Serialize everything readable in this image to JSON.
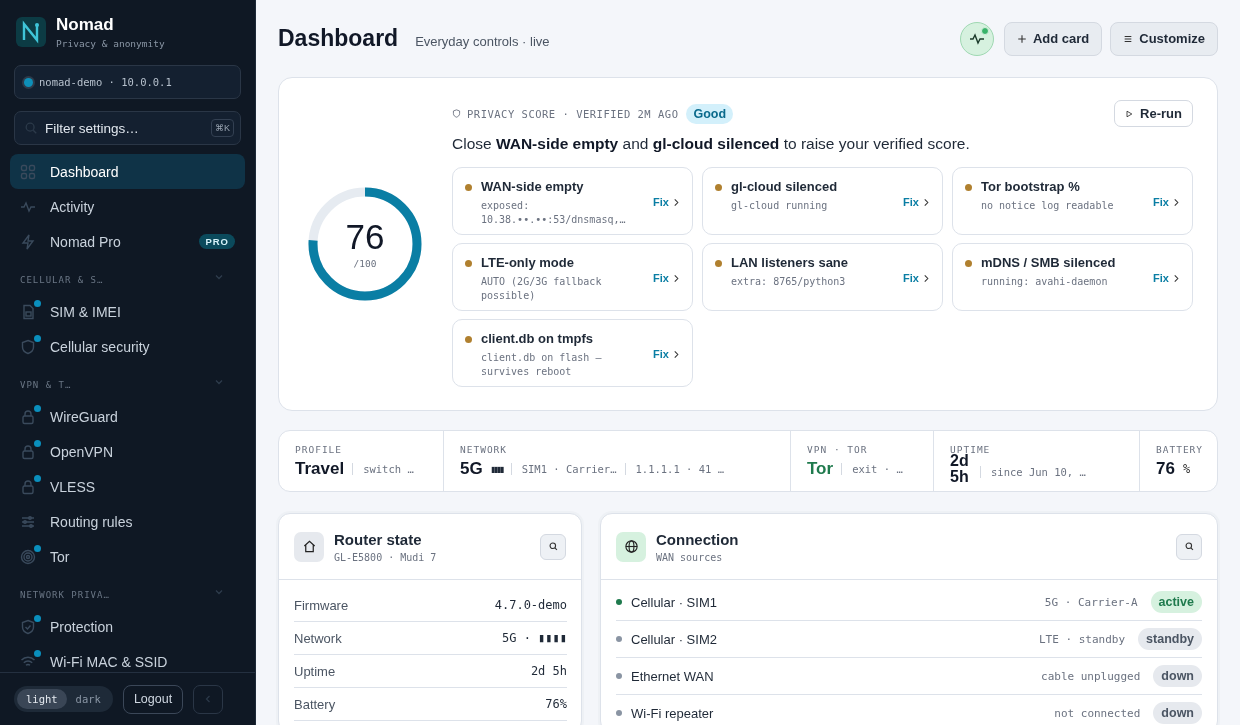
{
  "brand": {
    "name": "Nomad",
    "tagline": "Privacy & anonymity"
  },
  "device": {
    "label": "nomad-demo · 10.0.0.1",
    "online": true
  },
  "filter": {
    "placeholder": "Filter settings…",
    "shortcut": "⌘K"
  },
  "nav": [
    {
      "label": "Dashboard",
      "selected": true,
      "dot": false
    },
    {
      "label": "Activity",
      "selected": false,
      "dot": false
    },
    {
      "label": "Nomad Pro",
      "selected": false,
      "dot": false,
      "badge": "PRO"
    }
  ],
  "sections": [
    {
      "title": "CELLULAR & S…",
      "expanded": true,
      "items": [
        {
          "label": "SIM & IMEI",
          "selected": false,
          "dot": true
        },
        {
          "label": "Cellular security",
          "selected": false,
          "dot": true
        }
      ]
    },
    {
      "title": "VPN & T…",
      "expanded": true,
      "items": [
        {
          "label": "WireGuard",
          "selected": false,
          "dot": true
        },
        {
          "label": "OpenVPN",
          "selected": false,
          "dot": true
        },
        {
          "label": "VLESS",
          "selected": false,
          "dot": true
        },
        {
          "label": "Routing rules",
          "selected": false,
          "dot": false
        },
        {
          "label": "Tor",
          "selected": false,
          "dot": true
        }
      ]
    },
    {
      "title": "NETWORK PRIVA…",
      "expanded": true,
      "items": [
        {
          "label": "Protection",
          "selected": false,
          "dot": true
        },
        {
          "label": "Wi-Fi MAC & SSID",
          "selected": false,
          "dot": true
        }
      ]
    }
  ],
  "theme": [
    {
      "label": "light",
      "selected": true
    },
    {
      "label": "dark",
      "selected": false
    }
  ],
  "logout": "Logout",
  "header": {
    "title": "Dashboard",
    "subtitle": "Everyday controls · live",
    "add": "Add card",
    "customize": "Customize",
    "pulse_alert": true
  },
  "score": {
    "value": "76",
    "max": "/100",
    "level": 0.76,
    "meta": "PRIVACY SCORE · VERIFIED 2M AGO",
    "grade": "Good",
    "rerun": "Re-run",
    "message": "Close **WAN-side empty** and **gl-cloud silenced** to raise your verified score.",
    "checks": [
      {
        "title": "WAN-side empty",
        "detail": "exposed: 10.38.••.••:53/dnsmasq,…",
        "fix": "Fix"
      },
      {
        "title": "gl-cloud silenced",
        "detail": "gl-cloud running",
        "fix": "Fix"
      },
      {
        "title": "Tor bootstrap %",
        "detail": "no notice log readable",
        "fix": "Fix"
      },
      {
        "title": "LTE-only mode",
        "detail": "AUTO (2G/3G fallback possible)",
        "fix": "Fix"
      },
      {
        "title": "LAN listeners sane",
        "detail": "extra: 8765/python3",
        "fix": "Fix"
      },
      {
        "title": "mDNS / SMB silenced",
        "detail": "running: avahi-daemon",
        "fix": "Fix"
      },
      {
        "title": "client.db on tmpfs",
        "detail": "client.db on flash — survives reboot",
        "fix": "Fix"
      }
    ]
  },
  "stats": [
    {
      "label": "PROFILE",
      "value": "Travel",
      "color": "#111827",
      "extras": [
        "switch …"
      ]
    },
    {
      "label": "NETWORK",
      "value": "5G",
      "bars": "▮▮▮▮",
      "color": "#111827",
      "extras": [
        "SIM1 · Carrier…",
        "1.1.1.1 · 41 …"
      ]
    },
    {
      "label": "VPN · TOR",
      "value": "Tor",
      "color": "#1f7a4d",
      "extras": [
        "exit · …"
      ]
    },
    {
      "label": "UPTIME",
      "value": "2d 5h",
      "color": "#111827",
      "extras": [
        "since Jun 10, …"
      ]
    },
    {
      "label": "BATTERY",
      "value": "76",
      "unit": "%",
      "color": "#111827"
    }
  ],
  "router": {
    "title": "Router state",
    "subtitle": "GL-E5800 · Mudi 7",
    "rows": [
      {
        "label": "Firmware",
        "value": "4.7.0-demo"
      },
      {
        "label": "Network",
        "value": "5G · ▮▮▮▮"
      },
      {
        "label": "Uptime",
        "value": "2d 5h"
      },
      {
        "label": "Battery",
        "value": "76%"
      }
    ]
  },
  "connection": {
    "title": "Connection",
    "subtitle": "WAN sources",
    "rows": [
      {
        "name": "Cellular · SIM1",
        "detail": "5G · Carrier-A",
        "status": "active",
        "kind": "active",
        "color": "#1f7a4d"
      },
      {
        "name": "Cellular · SIM2",
        "detail": "LTE · standby",
        "status": "standby",
        "kind": "idle",
        "color": "#8a94a3"
      },
      {
        "name": "Ethernet WAN",
        "detail": "cable unplugged",
        "status": "down",
        "kind": "idle",
        "color": "#8a94a3"
      },
      {
        "name": "Wi-Fi repeater",
        "detail": "not connected",
        "status": "down",
        "kind": "idle",
        "color": "#8a94a3"
      }
    ]
  }
}
